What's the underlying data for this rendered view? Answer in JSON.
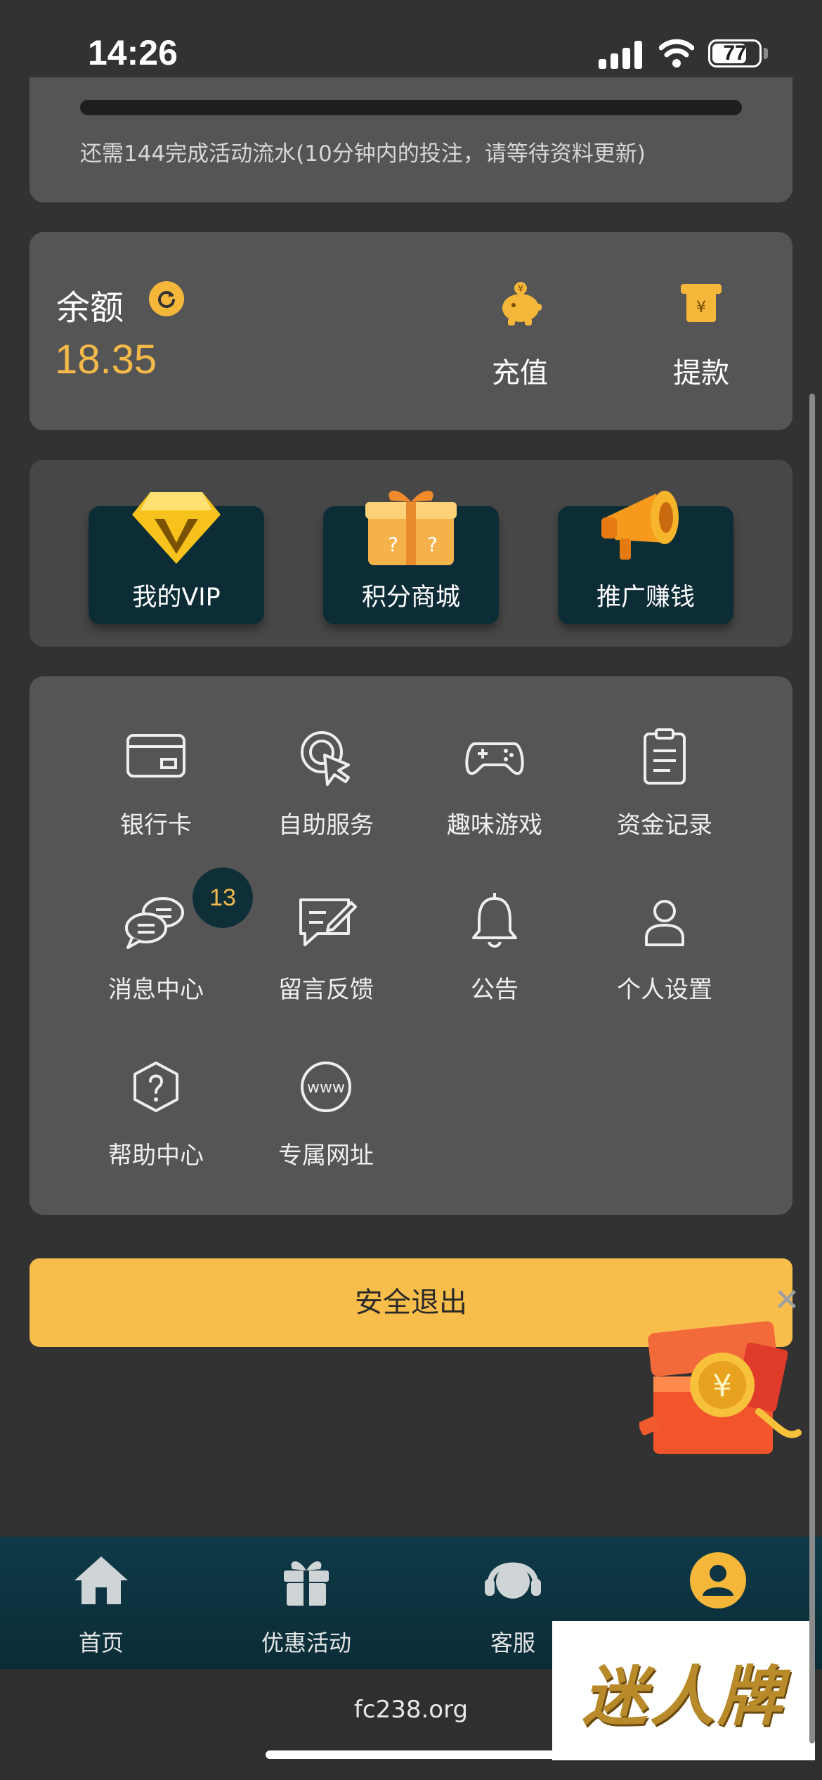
{
  "status_bar": {
    "time": "14:26",
    "battery": "77",
    "battery_level": 0.77
  },
  "activity": {
    "note": "还需144完成活动流水(10分钟内的投注，请等待资料更新)"
  },
  "balance": {
    "label": "余额",
    "value": "18.35",
    "deposit_label": "充值",
    "withdraw_label": "提款"
  },
  "promos": [
    {
      "label": "我的VIP",
      "icon": "diamond-vip-icon"
    },
    {
      "label": "积分商城",
      "icon": "gift-box-icon"
    },
    {
      "label": "推广赚钱",
      "icon": "megaphone-icon"
    }
  ],
  "menu": [
    {
      "label": "银行卡",
      "icon": "bank-card-icon"
    },
    {
      "label": "自助服务",
      "icon": "self-service-icon"
    },
    {
      "label": "趣味游戏",
      "icon": "gamepad-icon"
    },
    {
      "label": "资金记录",
      "icon": "clipboard-icon"
    },
    {
      "label": "消息中心",
      "icon": "chat-bubbles-icon",
      "badge": "13"
    },
    {
      "label": "留言反馈",
      "icon": "feedback-icon"
    },
    {
      "label": "公告",
      "icon": "bell-icon"
    },
    {
      "label": "个人设置",
      "icon": "user-icon"
    },
    {
      "label": "帮助中心",
      "icon": "help-icon"
    },
    {
      "label": "专属网址",
      "icon": "www-icon"
    }
  ],
  "logout_label": "安全退出",
  "float_ad": {
    "close": "✕"
  },
  "tabs": [
    {
      "label": "首页",
      "icon": "home-icon"
    },
    {
      "label": "优惠活动",
      "icon": "gift-icon"
    },
    {
      "label": "客服",
      "icon": "headset-icon"
    },
    {
      "label": "",
      "icon": "profile-icon",
      "active": true
    }
  ],
  "browser": {
    "url": "fc238.org"
  },
  "watermark": "迷人牌",
  "colors": {
    "accent": "#f8be4c",
    "card": "#555555",
    "background": "#323232",
    "tabbar": "#0e3a48"
  }
}
